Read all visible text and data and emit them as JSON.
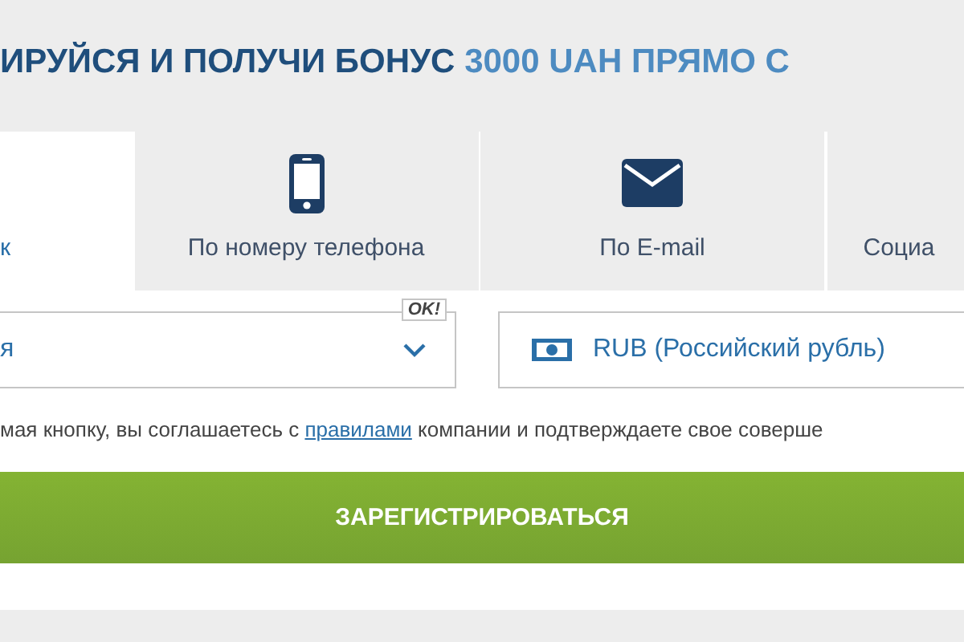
{
  "heading": {
    "text": "ИРУЙСЯ И ПОЛУЧИ БОНУС",
    "highlight": "3000 UAH ПРЯМО С"
  },
  "tabs": [
    {
      "label": "к",
      "kind": "plain",
      "selected": true
    },
    {
      "label": "По номеру телефона",
      "kind": "phone",
      "selected": false
    },
    {
      "label": "По E-mail",
      "kind": "email",
      "selected": false
    },
    {
      "label": "Социа",
      "kind": "plain",
      "selected": false
    }
  ],
  "country": {
    "value": "я",
    "badge": "OK!"
  },
  "currency": {
    "value": "RUB (Российский рубль)"
  },
  "agreement": {
    "before": "мая кнопку, вы соглашаетесь с",
    "link": "правилами",
    "after": "компании и подтверждаете свое соверше"
  },
  "submit": "ЗАРЕГИСТРИРОВАТЬСЯ"
}
